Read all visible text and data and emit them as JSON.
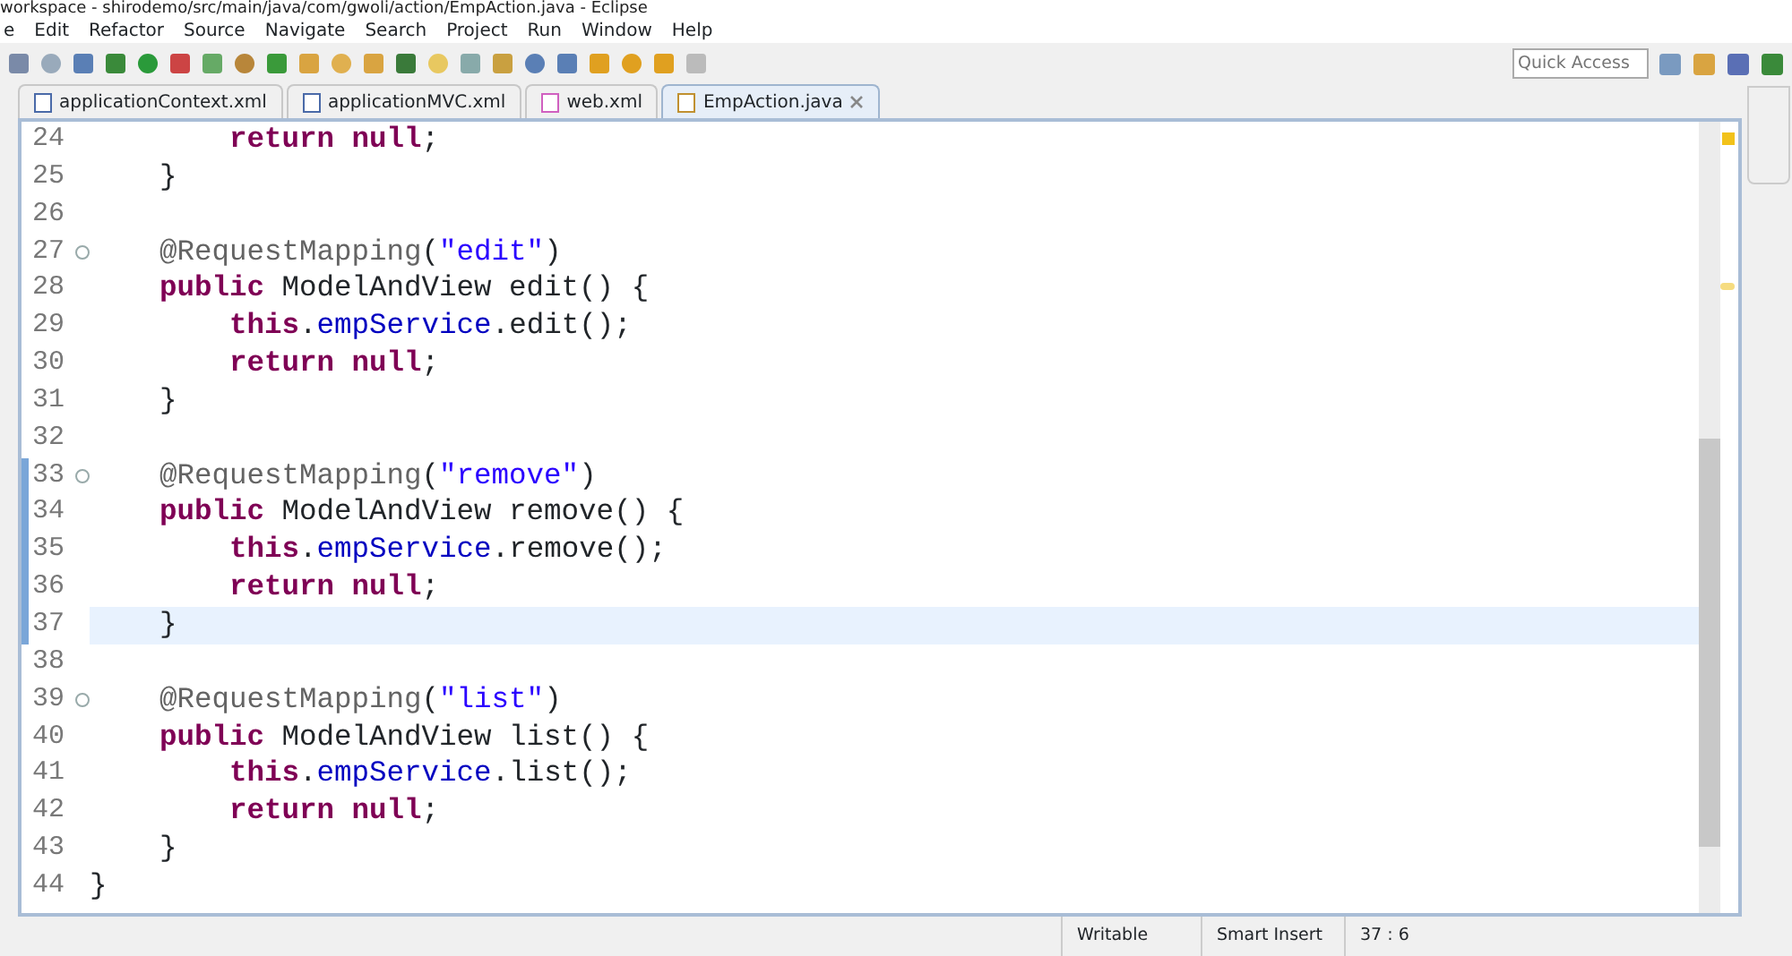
{
  "window": {
    "title": "workspace - shirodemo/src/main/java/com/gwoli/action/EmpAction.java - Eclipse"
  },
  "menu": [
    {
      "label": "e"
    },
    {
      "label": "Edit"
    },
    {
      "label": "Refactor"
    },
    {
      "label": "Source"
    },
    {
      "label": "Navigate"
    },
    {
      "label": "Search"
    },
    {
      "label": "Project"
    },
    {
      "label": "Run"
    },
    {
      "label": "Window"
    },
    {
      "label": "Help"
    }
  ],
  "quick_access": {
    "placeholder": "Quick Access"
  },
  "tabs": [
    {
      "label": "applicationContext.xml",
      "kind": "xml",
      "selected": false
    },
    {
      "label": "applicationMVC.xml",
      "kind": "xml",
      "selected": false
    },
    {
      "label": "web.xml",
      "kind": "web",
      "selected": false
    },
    {
      "label": "EmpAction.java",
      "kind": "java",
      "selected": true
    }
  ],
  "editor": {
    "lines": [
      {
        "number": "24",
        "fold": false,
        "current": false,
        "changed": false,
        "tokens": [
          {
            "t": "        return",
            "kind": "kw"
          },
          {
            "t": " null",
            "kind": "kw"
          },
          {
            "t": ";",
            "kind": "plain"
          }
        ]
      },
      {
        "number": "25",
        "fold": false,
        "current": false,
        "changed": false,
        "tokens": [
          {
            "t": "    }",
            "kind": "plain"
          }
        ]
      },
      {
        "number": "26",
        "fold": false,
        "current": false,
        "changed": false
      },
      {
        "number": "27",
        "fold": true,
        "current": false,
        "changed": false,
        "tokens": [
          {
            "t": "    @RequestMapping",
            "kind": "ann"
          },
          {
            "t": "(",
            "kind": "plain"
          },
          {
            "t": "\"edit\"",
            "kind": "str"
          },
          {
            "t": ")",
            "kind": "plain"
          }
        ]
      },
      {
        "number": "28",
        "fold": false,
        "current": false,
        "changed": false,
        "tokens": [
          {
            "t": "    public",
            "kind": "kw"
          },
          {
            "t": " ModelAndView edit() {",
            "kind": "plain"
          }
        ]
      },
      {
        "number": "29",
        "fold": false,
        "current": false,
        "changed": false,
        "tokens": [
          {
            "t": "        this",
            "kind": "kw"
          },
          {
            "t": ".",
            "kind": "plain"
          },
          {
            "t": "empService",
            "kind": "field"
          },
          {
            "t": ".edit();",
            "kind": "plain"
          }
        ]
      },
      {
        "number": "30",
        "fold": false,
        "current": false,
        "changed": false,
        "tokens": [
          {
            "t": "        return",
            "kind": "kw"
          },
          {
            "t": " null",
            "kind": "kw"
          },
          {
            "t": ";",
            "kind": "plain"
          }
        ]
      },
      {
        "number": "31",
        "fold": false,
        "current": false,
        "changed": false,
        "tokens": [
          {
            "t": "    }",
            "kind": "plain"
          }
        ]
      },
      {
        "number": "32",
        "fold": false,
        "current": false,
        "changed": false
      },
      {
        "number": "33",
        "fold": true,
        "current": false,
        "changed": true,
        "tokens": [
          {
            "t": "    @RequestMapping",
            "kind": "ann"
          },
          {
            "t": "(",
            "kind": "plain"
          },
          {
            "t": "\"remove\"",
            "kind": "str"
          },
          {
            "t": ")",
            "kind": "plain"
          }
        ]
      },
      {
        "number": "34",
        "fold": false,
        "current": false,
        "changed": true,
        "tokens": [
          {
            "t": "    public",
            "kind": "kw"
          },
          {
            "t": " ModelAndView remove() {",
            "kind": "plain"
          }
        ]
      },
      {
        "number": "35",
        "fold": false,
        "current": false,
        "changed": true,
        "tokens": [
          {
            "t": "        this",
            "kind": "kw"
          },
          {
            "t": ".",
            "kind": "plain"
          },
          {
            "t": "empService",
            "kind": "field"
          },
          {
            "t": ".remove();",
            "kind": "plain"
          }
        ]
      },
      {
        "number": "36",
        "fold": false,
        "current": false,
        "changed": true,
        "tokens": [
          {
            "t": "        return",
            "kind": "kw"
          },
          {
            "t": " null",
            "kind": "kw"
          },
          {
            "t": ";",
            "kind": "plain"
          }
        ]
      },
      {
        "number": "37",
        "fold": false,
        "current": true,
        "changed": true,
        "tokens": [
          {
            "t": "    }",
            "kind": "plain"
          }
        ]
      },
      {
        "number": "38",
        "fold": false,
        "current": false,
        "changed": false
      },
      {
        "number": "39",
        "fold": true,
        "current": false,
        "changed": false,
        "tokens": [
          {
            "t": "    @RequestMapping",
            "kind": "ann"
          },
          {
            "t": "(",
            "kind": "plain"
          },
          {
            "t": "\"list\"",
            "kind": "str"
          },
          {
            "t": ")",
            "kind": "plain"
          }
        ]
      },
      {
        "number": "40",
        "fold": false,
        "current": false,
        "changed": false,
        "tokens": [
          {
            "t": "    public",
            "kind": "kw"
          },
          {
            "t": " ModelAndView list() {",
            "kind": "plain"
          }
        ]
      },
      {
        "number": "41",
        "fold": false,
        "current": false,
        "changed": false,
        "tokens": [
          {
            "t": "        this",
            "kind": "kw"
          },
          {
            "t": ".",
            "kind": "plain"
          },
          {
            "t": "empService",
            "kind": "field"
          },
          {
            "t": ".list();",
            "kind": "plain"
          }
        ]
      },
      {
        "number": "42",
        "fold": false,
        "current": false,
        "changed": false,
        "tokens": [
          {
            "t": "        return",
            "kind": "kw"
          },
          {
            "t": " null",
            "kind": "kw"
          },
          {
            "t": ";",
            "kind": "plain"
          }
        ]
      },
      {
        "number": "43",
        "fold": false,
        "current": false,
        "changed": false,
        "tokens": [
          {
            "t": "    }",
            "kind": "plain"
          }
        ]
      },
      {
        "number": "44",
        "fold": false,
        "current": false,
        "changed": false,
        "tokens": [
          {
            "t": "}",
            "kind": "plain"
          }
        ]
      }
    ]
  },
  "status_bar": [
    {
      "text": "Writable"
    },
    {
      "text": "Smart Insert"
    },
    {
      "text": "37 : 6"
    }
  ]
}
